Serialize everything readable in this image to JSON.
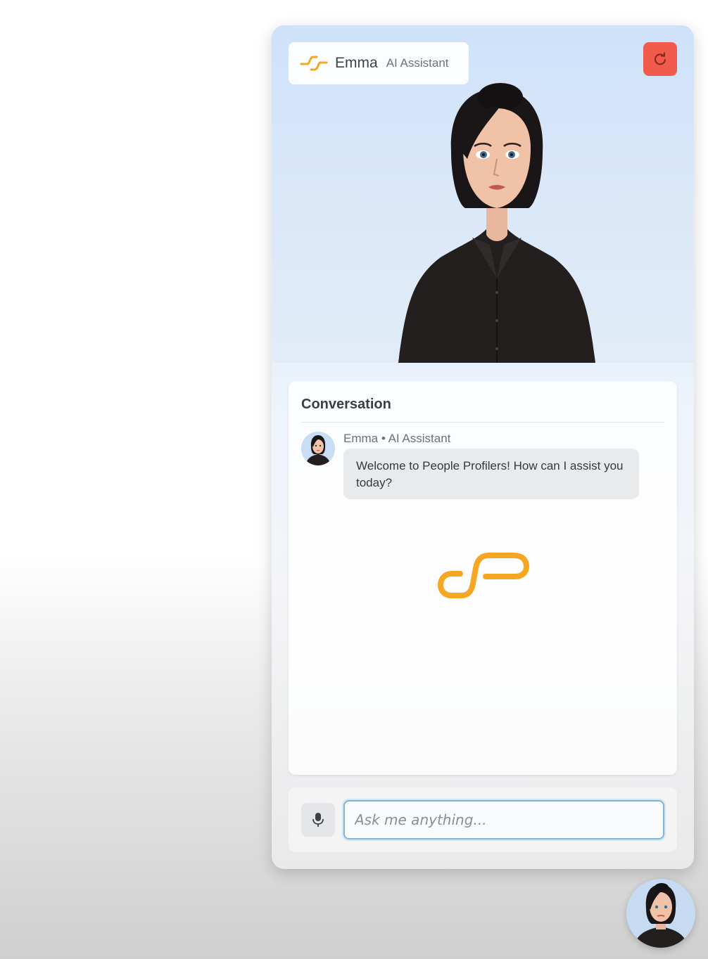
{
  "widget": {
    "header": {
      "name": "Emma",
      "role": "AI Assistant",
      "brand_icon": "people-profilers-logo-icon",
      "reset_icon": "reset-icon"
    },
    "conversation": {
      "title": "Conversation",
      "messages": [
        {
          "sender": "Emma • AI Assistant",
          "text": "Welcome to People Profilers! How can I assist you today?",
          "avatar_icon": "emma-avatar-icon"
        }
      ]
    },
    "input": {
      "placeholder": "Ask me anything...",
      "value": "",
      "mic_icon": "microphone-icon"
    }
  },
  "colors": {
    "brand_orange": "#f5a623",
    "reset_red": "#f25a4c",
    "input_border": "#7fb6d9"
  }
}
